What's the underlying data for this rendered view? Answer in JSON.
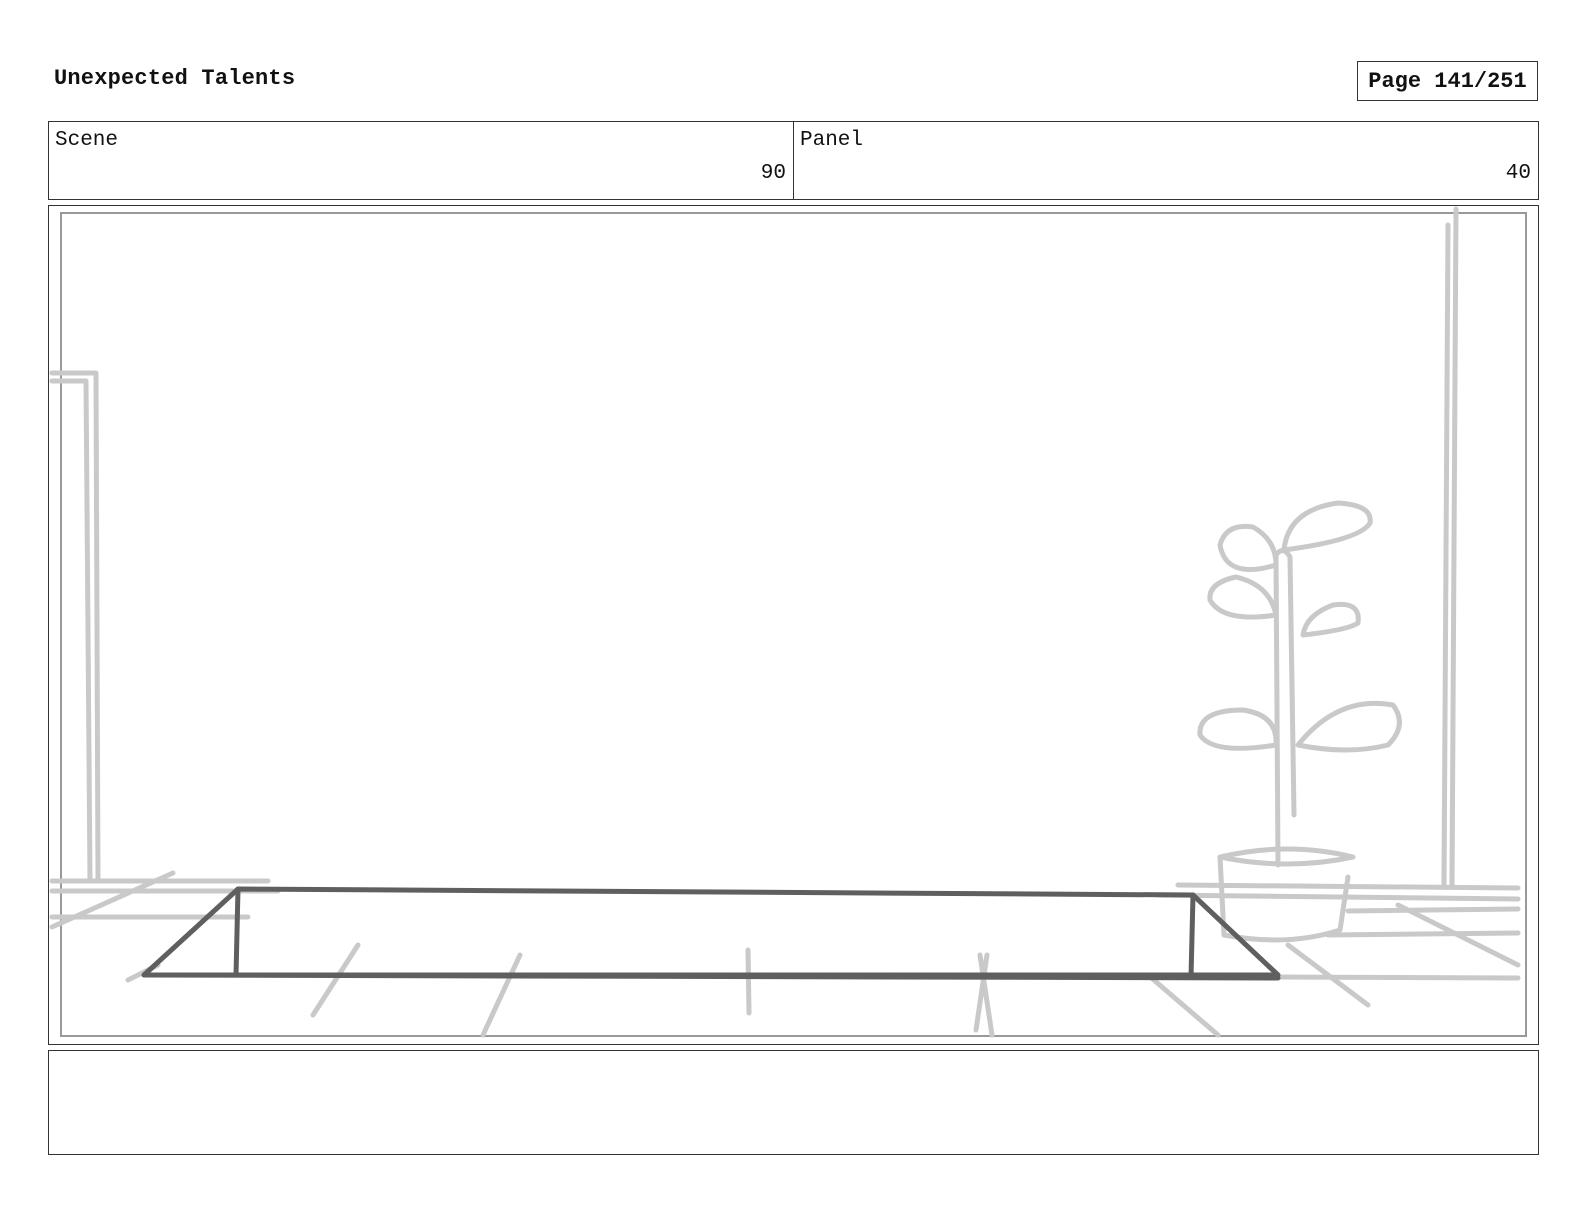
{
  "header": {
    "title": "Unexpected Talents",
    "page": "Page 141/251"
  },
  "info": {
    "scene_label": "Scene",
    "scene_value": "90",
    "panel_label": "Panel",
    "panel_value": "40"
  },
  "sketch": {
    "line_color": "#5f5f5f",
    "background_line_color": "#c9c9c9"
  },
  "notes": {
    "text": ""
  }
}
